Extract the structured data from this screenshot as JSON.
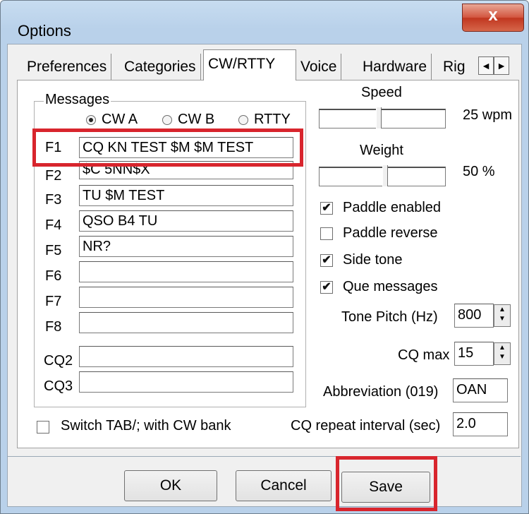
{
  "window": {
    "title": "Options",
    "close_glyph": "x"
  },
  "tabs": [
    "Preferences",
    "Categories",
    "CW/RTTY",
    "Voice",
    "Hardware",
    "Rig"
  ],
  "tab_scroll": {
    "left": "◄",
    "right": "►"
  },
  "messages": {
    "group_label": "Messages",
    "radios": [
      {
        "label": "CW A",
        "selected": true
      },
      {
        "label": "CW B",
        "selected": false
      },
      {
        "label": "RTTY",
        "selected": false
      }
    ],
    "fields": [
      {
        "key": "F1",
        "value": "CQ KN TEST $M $M TEST"
      },
      {
        "key": "F2",
        "value": "$C 5NN$X"
      },
      {
        "key": "F3",
        "value": "TU $M TEST"
      },
      {
        "key": "F4",
        "value": "QSO B4 TU"
      },
      {
        "key": "F5",
        "value": "NR?"
      },
      {
        "key": "F6",
        "value": ""
      },
      {
        "key": "F7",
        "value": ""
      },
      {
        "key": "F8",
        "value": ""
      },
      {
        "key": "CQ2",
        "value": ""
      },
      {
        "key": "CQ3",
        "value": ""
      }
    ]
  },
  "speed": {
    "label": "Speed",
    "value": "25 wpm",
    "slider_fraction": 0.45
  },
  "weight": {
    "label": "Weight",
    "value": "50 %",
    "slider_fraction": 0.5
  },
  "checkboxes": [
    {
      "label": "Paddle enabled",
      "checked": true
    },
    {
      "label": "Paddle reverse",
      "checked": false
    },
    {
      "label": "Side tone",
      "checked": true
    },
    {
      "label": "Que messages",
      "checked": true
    }
  ],
  "tone_pitch": {
    "label": "Tone Pitch (Hz)",
    "value": "800"
  },
  "cq_max": {
    "label": "CQ max",
    "value": "15"
  },
  "abbreviation": {
    "label": "Abbreviation (019)",
    "value": "OAN"
  },
  "cq_repeat": {
    "label": "CQ repeat interval (sec)",
    "value": "2.0"
  },
  "switch_tab": {
    "label": "Switch TAB/; with CW bank",
    "checked": false
  },
  "buttons": {
    "ok": "OK",
    "cancel": "Cancel",
    "save": "Save"
  },
  "check_glyph": "✔",
  "spin_glyphs": {
    "up": "▲",
    "down": "▼"
  },
  "highlight_color": "#d8252d"
}
